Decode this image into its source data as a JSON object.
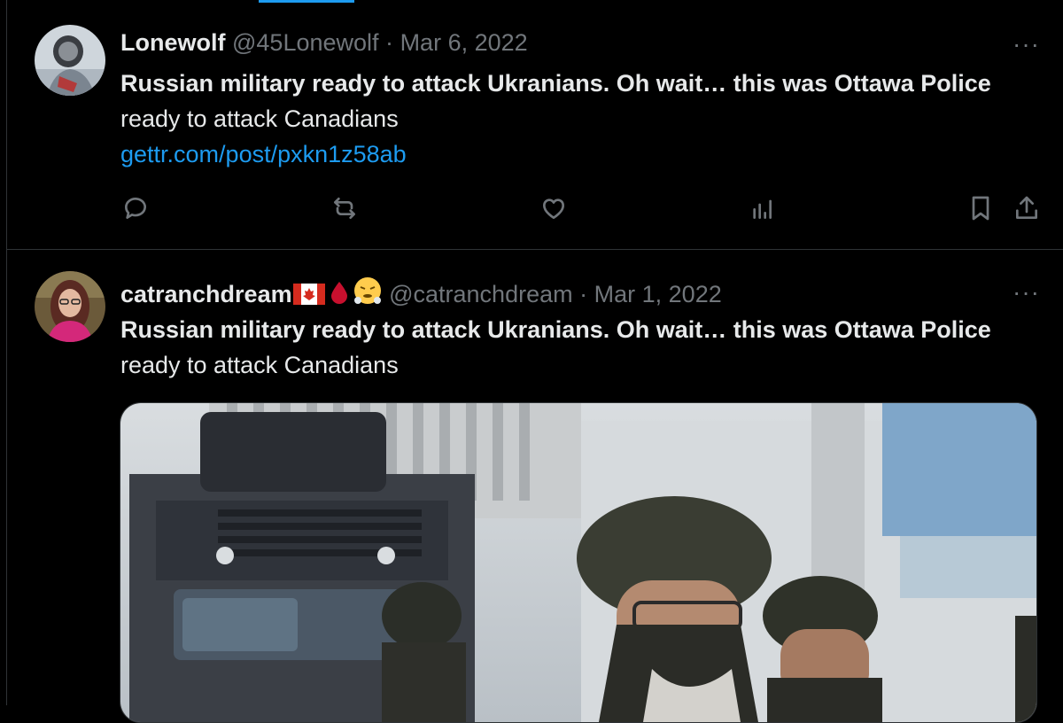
{
  "tweets": [
    {
      "display_name": "Lonewolf",
      "handle": "@45Lonewolf",
      "separator": "·",
      "date": "Mar 6, 2022",
      "more_label": "···",
      "text_bold": "Russian military ready to attack Ukranians. Oh wait… this was Ottawa Police",
      "text_normal": " ready to attack Canadians",
      "link": "gettr.com/post/pxkn1z58ab",
      "actions": [
        "reply-icon",
        "retweet-icon",
        "like-icon",
        "views-icon",
        "bookmark-icon",
        "share-icon"
      ]
    },
    {
      "display_name": "catranchdream",
      "handle": "@catranchdream",
      "separator": "·",
      "date": "Mar 1, 2022",
      "more_label": "···",
      "text_bold": "Russian military ready to attack Ukranians. Oh wait… this was Ottawa Police",
      "text_normal": " ready to attack Canadians",
      "name_emojis": [
        "canada-flag-icon",
        "drop-of-blood-icon",
        "steam-face-icon"
      ]
    }
  ],
  "colors": {
    "background": "#000000",
    "text": "#e7e9ea",
    "muted": "#71767b",
    "link": "#1d9bf0",
    "border": "#2f3336"
  }
}
